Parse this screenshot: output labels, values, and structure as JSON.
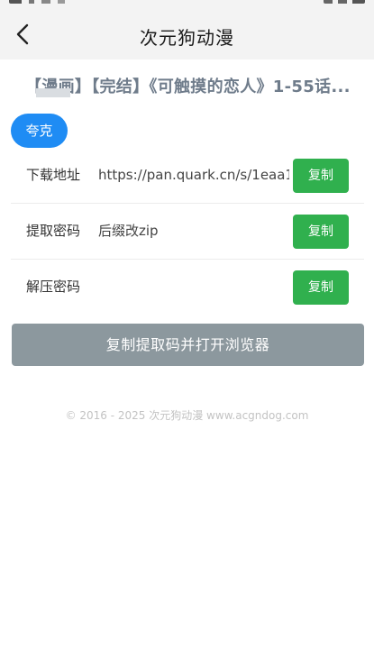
{
  "header": {
    "title": "次元狗动漫"
  },
  "post": {
    "title": "【漫画】【完结】《可触摸的恋人》1-55话..."
  },
  "tabs": [
    {
      "label": "夸克",
      "active": true
    }
  ],
  "rows": [
    {
      "label": "下载地址",
      "value": "https://pan.quark.cn/s/1eaa1",
      "button": "复制"
    },
    {
      "label": "提取密码",
      "value": "后缀改zip",
      "button": "复制"
    },
    {
      "label": "解压密码",
      "value": "",
      "button": "复制"
    }
  ],
  "actions": {
    "main_button": "复制提取码并打开浏览器"
  },
  "footer": {
    "text": "© 2016 - 2025 次元狗动漫 www.acgndog.com"
  },
  "colors": {
    "tab_active": "#1f8cf4",
    "copy_button": "#30b04e",
    "main_button": "#8c989e",
    "title_text": "#6f7c8b"
  },
  "icons": {
    "back": "chevron-left-icon"
  }
}
